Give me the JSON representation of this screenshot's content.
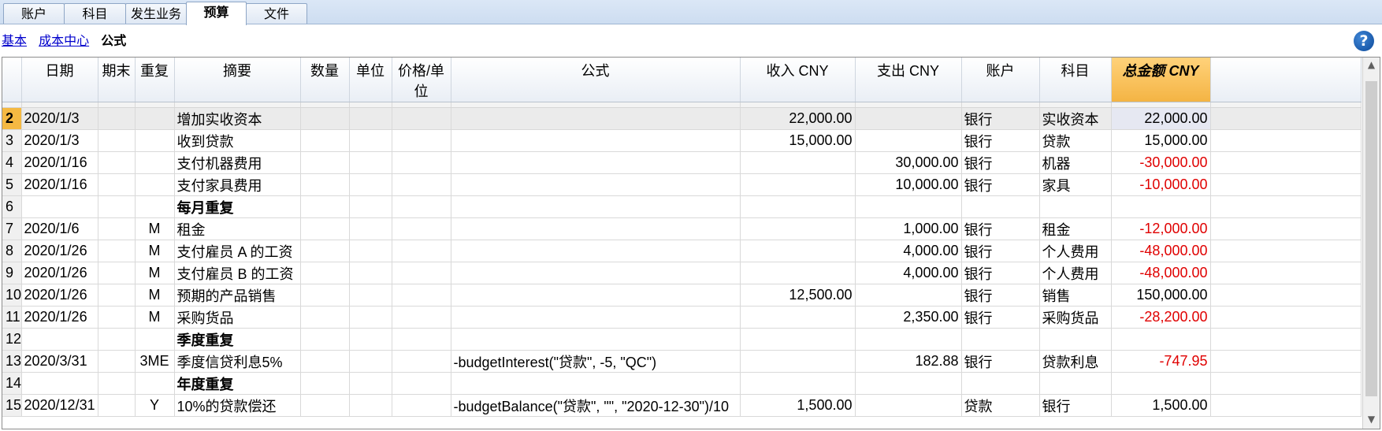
{
  "tabs": [
    {
      "label": "账户"
    },
    {
      "label": "科目"
    },
    {
      "label": "发生业务"
    },
    {
      "label": "预算"
    },
    {
      "label": "文件"
    }
  ],
  "subnav": {
    "basic": "基本",
    "cost_center": "成本中心",
    "formula": "公式"
  },
  "help_symbol": "?",
  "columns": {
    "date": "日期",
    "end": "期末",
    "repeat": "重复",
    "desc": "摘要",
    "qty": "数量",
    "unit": "单位",
    "price": "价格/单位",
    "formula": "公式",
    "income": "收入 CNY",
    "expense": "支出 CNY",
    "account": "账户",
    "category": "科目",
    "total": "总金额 CNY"
  },
  "rows": [
    {
      "n": "2",
      "date": "2020/1/3",
      "end": "",
      "repeat": "",
      "desc": "增加实收资本",
      "formula": "",
      "income": "22,000.00",
      "expense": "",
      "account": "银行",
      "category": "实收资本",
      "total": "22,000.00",
      "neg": false,
      "bold": false
    },
    {
      "n": "3",
      "date": "2020/1/3",
      "end": "",
      "repeat": "",
      "desc": "收到贷款",
      "formula": "",
      "income": "15,000.00",
      "expense": "",
      "account": "银行",
      "category": "贷款",
      "total": "15,000.00",
      "neg": false,
      "bold": false
    },
    {
      "n": "4",
      "date": "2020/1/16",
      "end": "",
      "repeat": "",
      "desc": "支付机器费用",
      "formula": "",
      "income": "",
      "expense": "30,000.00",
      "account": "银行",
      "category": "机器",
      "total": "-30,000.00",
      "neg": true,
      "bold": false
    },
    {
      "n": "5",
      "date": "2020/1/16",
      "end": "",
      "repeat": "",
      "desc": "支付家具费用",
      "formula": "",
      "income": "",
      "expense": "10,000.00",
      "account": "银行",
      "category": "家具",
      "total": "-10,000.00",
      "neg": true,
      "bold": false
    },
    {
      "n": "6",
      "date": "",
      "end": "",
      "repeat": "",
      "desc": "每月重复",
      "formula": "",
      "income": "",
      "expense": "",
      "account": "",
      "category": "",
      "total": "",
      "neg": false,
      "bold": true
    },
    {
      "n": "7",
      "date": "2020/1/6",
      "end": "",
      "repeat": "M",
      "desc": " 租金",
      "formula": "",
      "income": "",
      "expense": "1,000.00",
      "account": "银行",
      "category": "租金",
      "total": "-12,000.00",
      "neg": true,
      "bold": false
    },
    {
      "n": "8",
      "date": "2020/1/26",
      "end": "",
      "repeat": "M",
      "desc": "支付雇员 A 的工资",
      "formula": "",
      "income": "",
      "expense": "4,000.00",
      "account": "银行",
      "category": "个人费用",
      "total": "-48,000.00",
      "neg": true,
      "bold": false
    },
    {
      "n": "9",
      "date": "2020/1/26",
      "end": "",
      "repeat": "M",
      "desc": "支付雇员 B 的工资",
      "formula": "",
      "income": "",
      "expense": "4,000.00",
      "account": "银行",
      "category": "个人费用",
      "total": "-48,000.00",
      "neg": true,
      "bold": false
    },
    {
      "n": "10",
      "date": "2020/1/26",
      "end": "",
      "repeat": "M",
      "desc": "预期的产品销售",
      "formula": "",
      "income": "12,500.00",
      "expense": "",
      "account": "银行",
      "category": "销售",
      "total": "150,000.00",
      "neg": false,
      "bold": false
    },
    {
      "n": "11",
      "date": "2020/1/26",
      "end": "",
      "repeat": "M",
      "desc": "采购货品",
      "formula": "",
      "income": "",
      "expense": "2,350.00",
      "account": "银行",
      "category": "采购货品",
      "total": "-28,200.00",
      "neg": true,
      "bold": false
    },
    {
      "n": "12",
      "date": "",
      "end": "",
      "repeat": "",
      "desc": "季度重复",
      "formula": "",
      "income": "",
      "expense": "",
      "account": "",
      "category": "",
      "total": "",
      "neg": false,
      "bold": true
    },
    {
      "n": "13",
      "date": "2020/3/31",
      "end": "",
      "repeat": "3ME",
      "desc": "季度信贷利息5%",
      "formula": "-budgetInterest(\"贷款\", -5, \"QC\")",
      "income": "",
      "expense": "182.88",
      "account": "银行",
      "category": "贷款利息",
      "total": "-747.95",
      "neg": true,
      "bold": false
    },
    {
      "n": "14",
      "date": "",
      "end": "",
      "repeat": "",
      "desc": "年度重复",
      "formula": "",
      "income": "",
      "expense": "",
      "account": "",
      "category": "",
      "total": "",
      "neg": false,
      "bold": true
    },
    {
      "n": "15",
      "date": "2020/12/31",
      "end": "",
      "repeat": "Y",
      "desc": "10%的贷款偿还",
      "formula": "-budgetBalance(\"贷款\", \"\", \"2020-12-30\")/10",
      "income": "1,500.00",
      "expense": "",
      "account": "贷款",
      "category": "银行",
      "total": "1,500.00",
      "neg": false,
      "bold": false
    }
  ],
  "colors": {
    "negative": "#e00000",
    "selected_header": "#f5b942",
    "link": "#0000cc"
  },
  "icons": {
    "help": "help-icon",
    "scroll_up": "arrow-up-icon",
    "scroll_down": "arrow-down-icon"
  }
}
